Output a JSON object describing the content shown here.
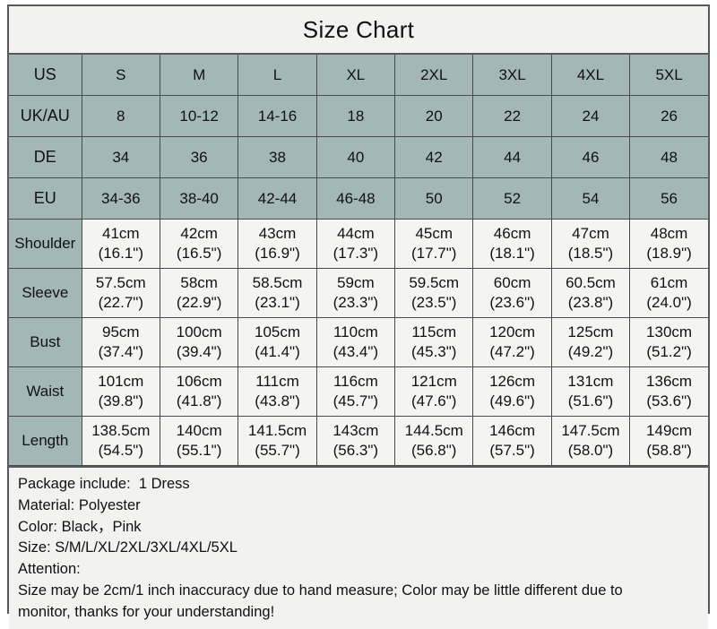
{
  "title": "Size Chart",
  "chart_data": {
    "type": "table",
    "title": "Size Chart",
    "columns": [
      "US",
      "S",
      "M",
      "L",
      "XL",
      "2XL",
      "3XL",
      "4XL",
      "5XL"
    ],
    "header_rows": [
      {
        "label": "US",
        "values": [
          "S",
          "M",
          "L",
          "XL",
          "2XL",
          "3XL",
          "4XL",
          "5XL"
        ]
      },
      {
        "label": "UK/AU",
        "values": [
          "8",
          "10-12",
          "14-16",
          "18",
          "20",
          "22",
          "24",
          "26"
        ]
      },
      {
        "label": "DE",
        "values": [
          "34",
          "36",
          "38",
          "40",
          "42",
          "44",
          "46",
          "48"
        ]
      },
      {
        "label": "EU",
        "values": [
          "34-36",
          "38-40",
          "42-44",
          "46-48",
          "50",
          "52",
          "54",
          "56"
        ]
      }
    ],
    "measurement_rows": [
      {
        "label": "Shoulder",
        "cm": [
          "41cm",
          "42cm",
          "43cm",
          "44cm",
          "45cm",
          "46cm",
          "47cm",
          "48cm"
        ],
        "inch": [
          "(16.1\")",
          "(16.5\")",
          "(16.9\")",
          "(17.3\")",
          "(17.7\")",
          "(18.1\")",
          "(18.5\")",
          "(18.9\")"
        ]
      },
      {
        "label": "Sleeve",
        "cm": [
          "57.5cm",
          "58cm",
          "58.5cm",
          "59cm",
          "59.5cm",
          "60cm",
          "60.5cm",
          "61cm"
        ],
        "inch": [
          "(22.7\")",
          "(22.9\")",
          "(23.1\")",
          "(23.3\")",
          "(23.5\")",
          "(23.6\")",
          "(23.8\")",
          "(24.0\")"
        ]
      },
      {
        "label": "Bust",
        "cm": [
          "95cm",
          "100cm",
          "105cm",
          "110cm",
          "115cm",
          "120cm",
          "125cm",
          "130cm"
        ],
        "inch": [
          "(37.4\")",
          "(39.4\")",
          "(41.4\")",
          "(43.4\")",
          "(45.3\")",
          "(47.2\")",
          "(49.2\")",
          "(51.2\")"
        ]
      },
      {
        "label": "Waist",
        "cm": [
          "101cm",
          "106cm",
          "111cm",
          "116cm",
          "121cm",
          "126cm",
          "131cm",
          "136cm"
        ],
        "inch": [
          "(39.8\")",
          "(41.8\")",
          "(43.8\")",
          "(45.7\")",
          "(47.6\")",
          "(49.6\")",
          "(51.6\")",
          "(53.6\")"
        ]
      },
      {
        "label": "Length",
        "cm": [
          "138.5cm",
          "140cm",
          "141.5cm",
          "143cm",
          "144.5cm",
          "146cm",
          "147.5cm",
          "149cm"
        ],
        "inch": [
          "(54.5\")",
          "(55.1\")",
          "(55.7\")",
          "(56.3\")",
          "(56.8\")",
          "(57.5\")",
          "(58.0\")",
          "(58.8\")"
        ]
      }
    ]
  },
  "notes": {
    "lines": [
      "Package include:  1 Dress",
      "Material: Polyester",
      "Color: Black，Pink",
      "Size: S/M/L/XL/2XL/3XL/4XL/5XL",
      "Attention:",
      "Size may be 2cm/1 inch inaccuracy due to hand measure; Color may be little different due to",
      "monitor, thanks for your understanding!"
    ],
    "line_0": "Package include:  1 Dress",
    "line_1": "Material: Polyester",
    "line_2": "Color: Black，Pink",
    "line_3": "Size: S/M/L/XL/2XL/3XL/4XL/5XL",
    "line_4": "Attention:",
    "line_5": "Size may be 2cm/1 inch inaccuracy due to hand measure; Color may be little different due to",
    "line_6": "monitor, thanks for your understanding!"
  },
  "colors": {
    "header_teal": "#a3b7b6",
    "cell_bg": "#f4f4f2",
    "panel_bg": "#f2f2f0",
    "border_outer": "#58595b",
    "border_inner": "#4a4a4a",
    "text": "#111111"
  }
}
